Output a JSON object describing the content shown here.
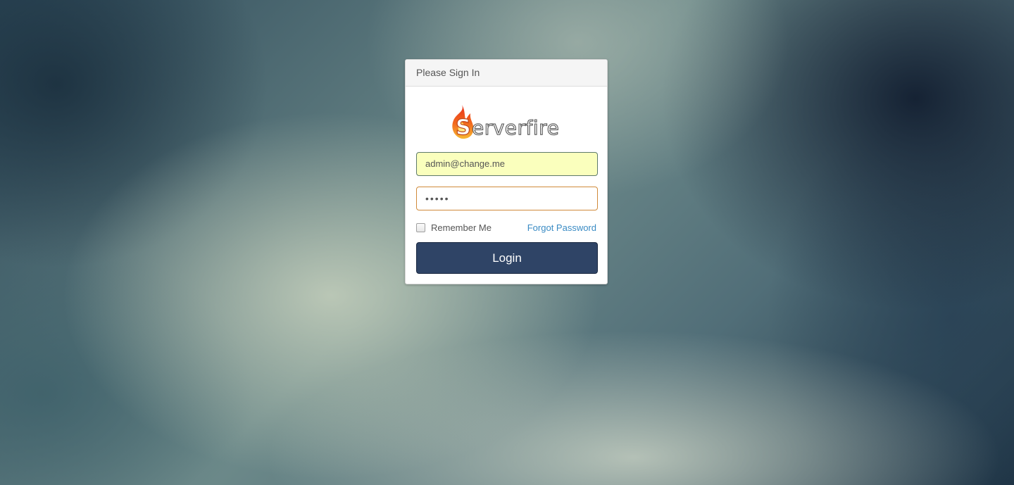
{
  "panel": {
    "heading": "Please Sign In"
  },
  "logo": {
    "text": "Serverfire",
    "icon": "flame-icon"
  },
  "form": {
    "email_value": "admin@change.me",
    "password_mask": "•••••",
    "remember_label": "Remember Me",
    "remember_checked": false,
    "forgot_label": "Forgot Password",
    "login_label": "Login"
  },
  "colors": {
    "button": "#2f4466",
    "link": "#3a8bc4",
    "autofill": "#faffbd",
    "focus_border": "#d08a3a"
  }
}
